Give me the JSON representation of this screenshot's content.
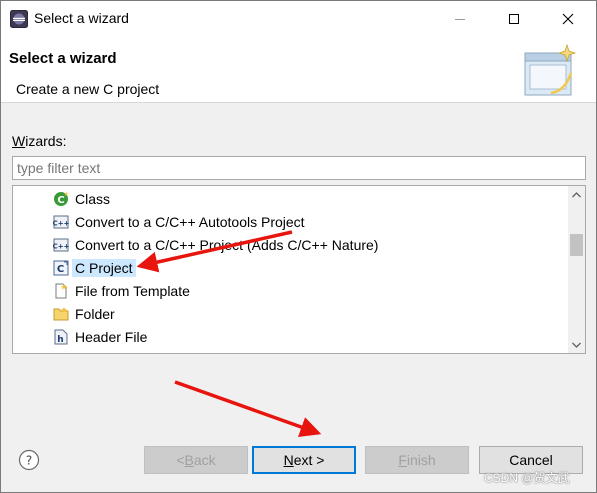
{
  "window": {
    "title": "Select a wizard",
    "icon": "eclipse-icon"
  },
  "banner": {
    "title": "Select a wizard",
    "description": "Create a new C project",
    "image": "wizard-banner-icon"
  },
  "wizards": {
    "label_first": "W",
    "label_rest": "izards:",
    "filter_placeholder": "type filter text",
    "filter_value": "",
    "items": [
      {
        "label": "Class",
        "icon": "class-icon",
        "selected": false
      },
      {
        "label": "Convert to a C/C++ Autotools Project",
        "icon": "cpp-convert-icon",
        "selected": false
      },
      {
        "label": "Convert to a C/C++ Project (Adds C/C++ Nature)",
        "icon": "cpp-convert-icon",
        "selected": false
      },
      {
        "label": "C Project",
        "icon": "c-project-icon",
        "selected": true
      },
      {
        "label": "File from Template",
        "icon": "file-template-icon",
        "selected": false
      },
      {
        "label": "Folder",
        "icon": "folder-icon",
        "selected": false
      },
      {
        "label": "Header File",
        "icon": "header-file-icon",
        "selected": false
      }
    ]
  },
  "buttons": {
    "back_prefix": "< ",
    "back_accel": "B",
    "back_rest": "ack",
    "next_accel": "N",
    "next_rest": "ext >",
    "finish_accel": "F",
    "finish_rest": "inish",
    "cancel": "Cancel"
  },
  "watermark": "CSDN @贺文武",
  "colors": {
    "selection": "#cce8ff",
    "default_button_border": "#0078d7",
    "arrow": "#e8150e"
  }
}
